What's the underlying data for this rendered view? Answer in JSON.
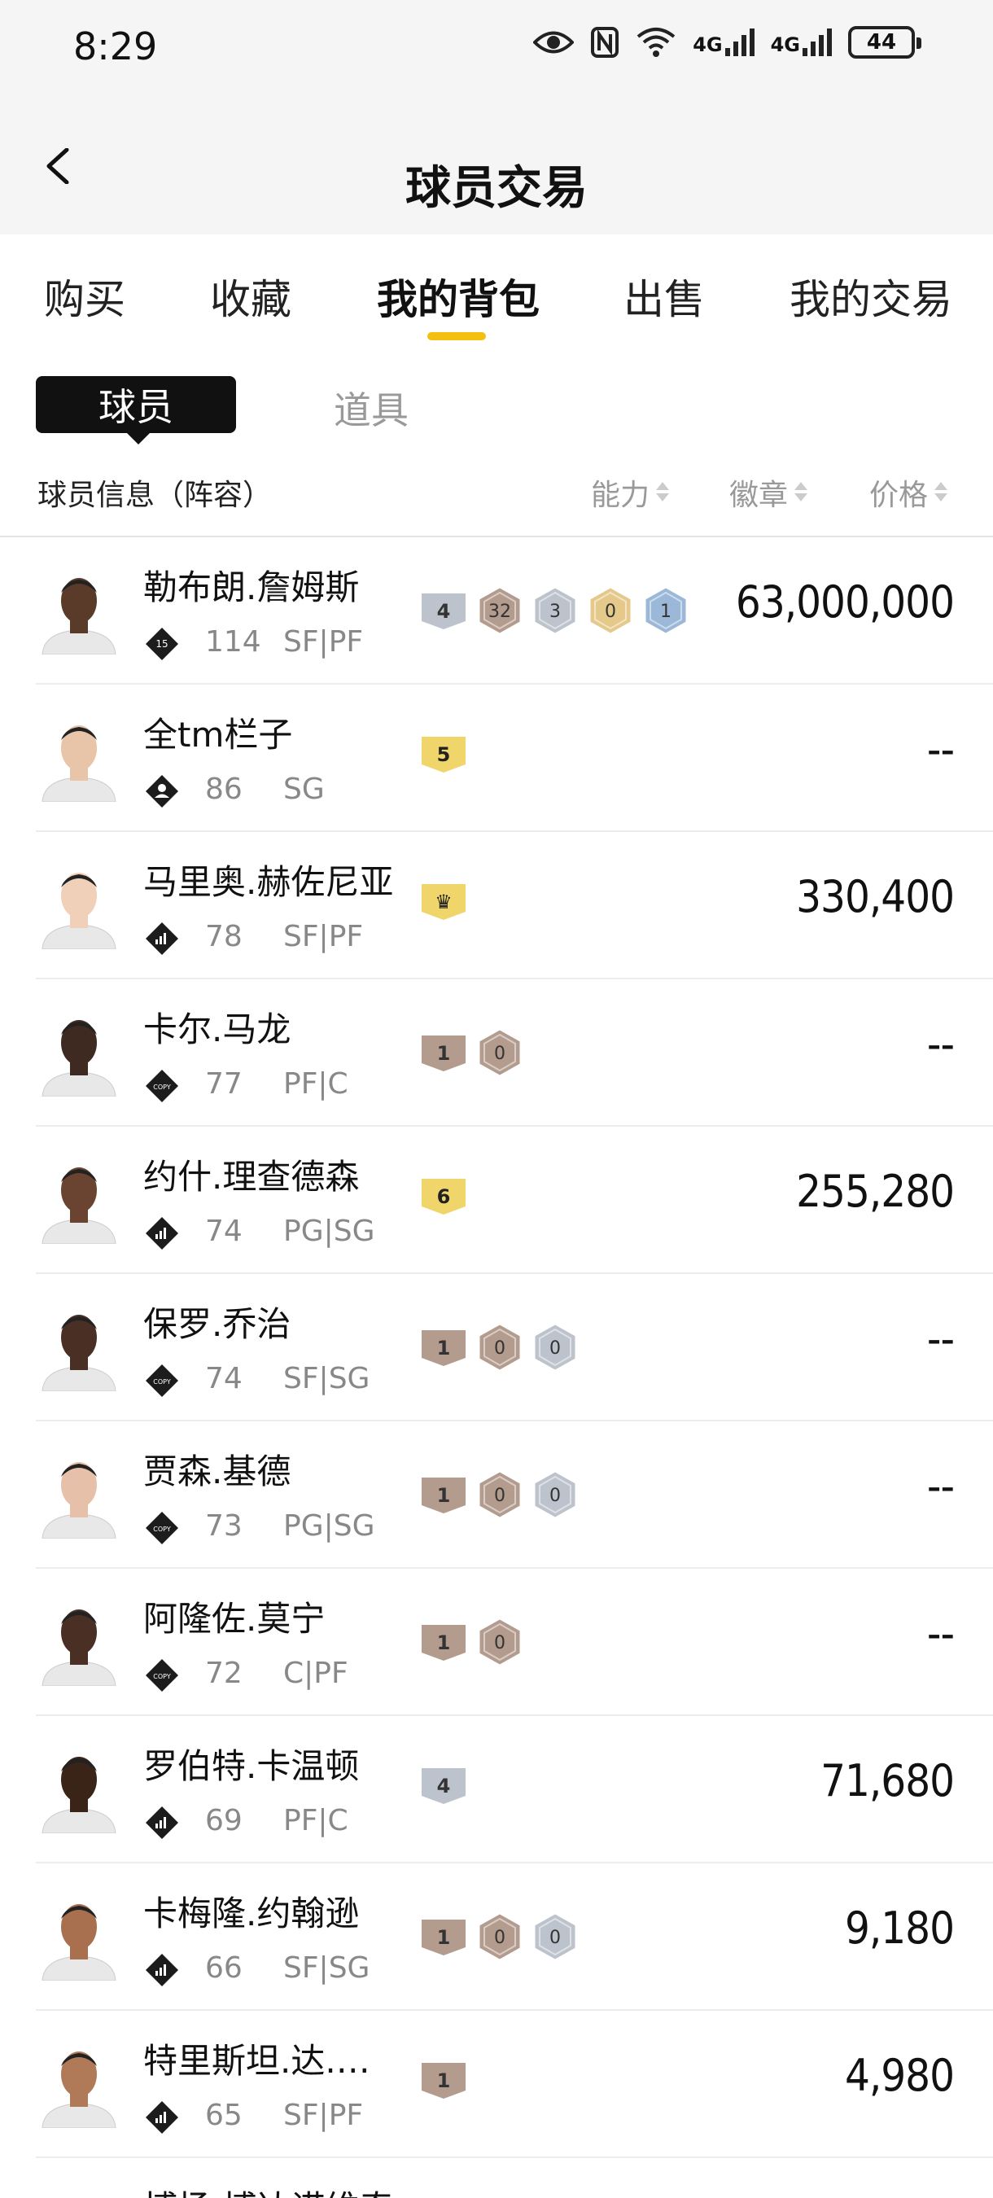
{
  "status_bar": {
    "time": "8:29",
    "network_label": "4G",
    "battery": "44"
  },
  "header": {
    "title": "球员交易"
  },
  "tabs": [
    {
      "label": "购买"
    },
    {
      "label": "收藏"
    },
    {
      "label": "我的背包",
      "active": true
    },
    {
      "label": "出售"
    },
    {
      "label": "我的交易"
    }
  ],
  "segment": {
    "player": "球员",
    "item": "道具"
  },
  "columns": {
    "info": "球员信息（阵容）",
    "ability": "能力",
    "badge": "徽章",
    "price": "价格"
  },
  "colors": {
    "accent": "#f3c012",
    "bronze": "#b39b8e",
    "silver": "#bcc3cc",
    "gold": "#e4c98a",
    "hof": "#9bb8d8",
    "yellow": "#efd56a"
  },
  "players": [
    {
      "name": "勒布朗.詹姆斯",
      "rank_icon": "rank-15-icon",
      "rank_text": "15",
      "ovr": "114",
      "pos": "SF|PF",
      "price": "63,000,000",
      "badges": [
        {
          "shape": "shield",
          "color": "silver",
          "text": "4"
        },
        {
          "shape": "hex",
          "color": "bronze",
          "text": "32"
        },
        {
          "shape": "hex",
          "color": "silver",
          "text": "3"
        },
        {
          "shape": "hex",
          "color": "gold",
          "text": "0"
        },
        {
          "shape": "hex",
          "color": "hof",
          "text": "1"
        }
      ],
      "skin": "#5a3a28"
    },
    {
      "name": "全tm栏子",
      "rank_icon": "person-rank-icon",
      "rank_text": "",
      "ovr": "86",
      "pos": "SG",
      "price": "--",
      "badges": [
        {
          "shape": "shield",
          "color": "yellow",
          "text": "5"
        }
      ],
      "skin": "#e8c4a8"
    },
    {
      "name": "马里奥.赫佐尼亚",
      "rank_icon": "bars-rank-icon",
      "rank_text": "",
      "ovr": "78",
      "pos": "SF|PF",
      "price": "330,400",
      "badges": [
        {
          "shape": "shield",
          "color": "yellow",
          "text": "♛"
        }
      ],
      "skin": "#f0d0b8"
    },
    {
      "name": "卡尔.马龙",
      "rank_icon": "copy-rank-icon",
      "rank_text": "COPY",
      "ovr": "77",
      "pos": "PF|C",
      "price": "--",
      "badges": [
        {
          "shape": "shield",
          "color": "bronze",
          "text": "1"
        },
        {
          "shape": "hex",
          "color": "bronze",
          "text": "0"
        }
      ],
      "skin": "#3e2a20"
    },
    {
      "name": "约什.理查德森",
      "rank_icon": "bars-rank-icon",
      "rank_text": "",
      "ovr": "74",
      "pos": "PG|SG",
      "price": "255,280",
      "badges": [
        {
          "shape": "shield",
          "color": "yellow",
          "text": "6"
        }
      ],
      "skin": "#6a4430"
    },
    {
      "name": "保罗.乔治",
      "rank_icon": "copy-rank-icon",
      "rank_text": "COPY",
      "ovr": "74",
      "pos": "SF|SG",
      "price": "--",
      "badges": [
        {
          "shape": "shield",
          "color": "bronze",
          "text": "1"
        },
        {
          "shape": "hex",
          "color": "bronze",
          "text": "0"
        },
        {
          "shape": "hex",
          "color": "silver",
          "text": "0"
        }
      ],
      "skin": "#4a3024"
    },
    {
      "name": "贾森.基德",
      "rank_icon": "copy-rank-icon",
      "rank_text": "COPY",
      "ovr": "73",
      "pos": "PG|SG",
      "price": "--",
      "badges": [
        {
          "shape": "shield",
          "color": "bronze",
          "text": "1"
        },
        {
          "shape": "hex",
          "color": "bronze",
          "text": "0"
        },
        {
          "shape": "hex",
          "color": "silver",
          "text": "0"
        }
      ],
      "skin": "#e6c0a8"
    },
    {
      "name": "阿隆佐.莫宁",
      "rank_icon": "copy-rank-icon",
      "rank_text": "COPY",
      "ovr": "72",
      "pos": "C|PF",
      "price": "--",
      "badges": [
        {
          "shape": "shield",
          "color": "bronze",
          "text": "1"
        },
        {
          "shape": "hex",
          "color": "bronze",
          "text": "0"
        }
      ],
      "skin": "#4a3024"
    },
    {
      "name": "罗伯特.卡温顿",
      "rank_icon": "bars-rank-icon",
      "rank_text": "",
      "ovr": "69",
      "pos": "PF|C",
      "price": "71,680",
      "badges": [
        {
          "shape": "shield",
          "color": "silver",
          "text": "4"
        }
      ],
      "skin": "#3a2418"
    },
    {
      "name": "卡梅隆.约翰逊",
      "rank_icon": "bars-rank-icon",
      "rank_text": "",
      "ovr": "66",
      "pos": "SF|SG",
      "price": "9,180",
      "badges": [
        {
          "shape": "shield",
          "color": "bronze",
          "text": "1"
        },
        {
          "shape": "hex",
          "color": "bronze",
          "text": "0"
        },
        {
          "shape": "hex",
          "color": "silver",
          "text": "0"
        }
      ],
      "skin": "#a97050"
    },
    {
      "name": "特里斯坦.达.席…",
      "rank_icon": "bars-rank-icon",
      "rank_text": "",
      "ovr": "65",
      "pos": "SF|PF",
      "price": "4,980",
      "badges": [
        {
          "shape": "shield",
          "color": "bronze",
          "text": "1"
        }
      ],
      "skin": "#b07a58"
    },
    {
      "name": "博扬.博达诺维奇",
      "rank_icon": "bars-rank-icon",
      "rank_text": "",
      "ovr": "",
      "pos": "",
      "price": "",
      "badges": [],
      "skin": "#e6c6b0"
    }
  ]
}
